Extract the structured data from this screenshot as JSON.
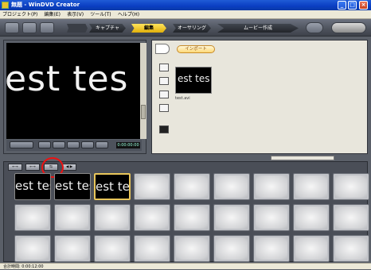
{
  "window": {
    "title": "無題 - WinDVD Creator"
  },
  "menu": [
    "プロジェクト(P)",
    "編集(E)",
    "表示(V)",
    "ツール(T)",
    "ヘルプ(H)"
  ],
  "steps": [
    {
      "label": "キャプチャ",
      "active": false
    },
    {
      "label": "編集",
      "active": true
    },
    {
      "label": "オーサリング",
      "active": false
    },
    {
      "label": "ムービー作成",
      "active": false
    }
  ],
  "preview": {
    "text": "est tes",
    "timecode": "0:00:00:00"
  },
  "import": {
    "tab_label": "インポート",
    "thumb_text": "est tes",
    "file_name": "test.avi"
  },
  "storyboard": {
    "buttons": [
      "←→",
      "←→",
      "⇆",
      "◀ ▶"
    ],
    "clips": [
      "est tes",
      "est tes",
      "est tes"
    ]
  },
  "status": {
    "total_time": "合計時間: 0:00:12:00"
  }
}
